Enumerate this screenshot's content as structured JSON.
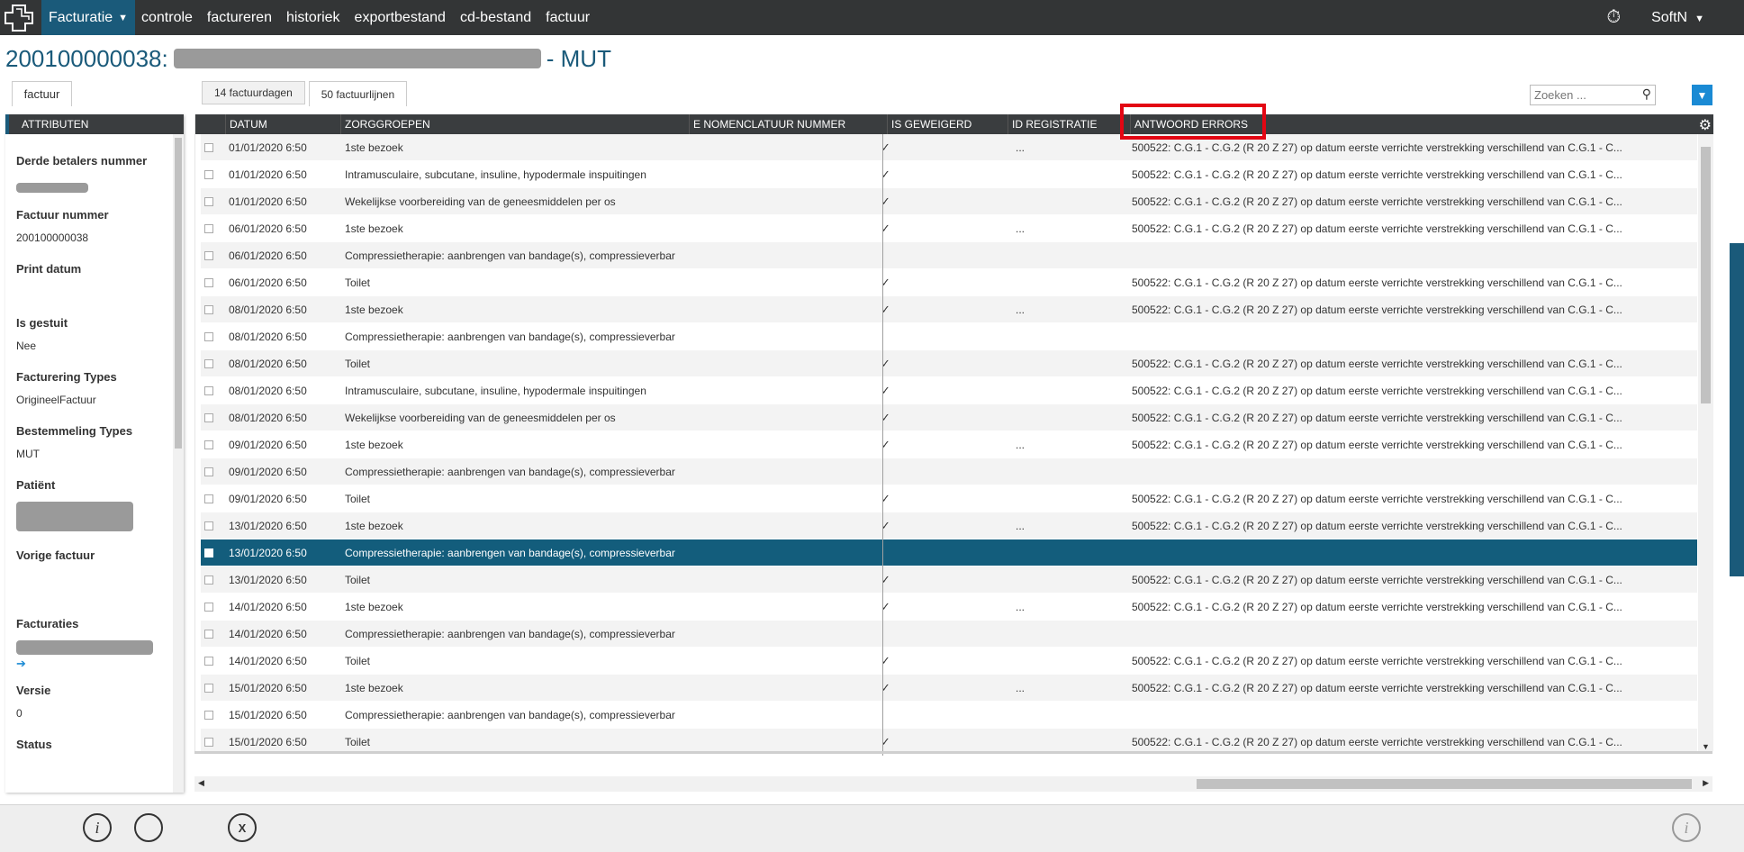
{
  "topbar": {
    "app_menu_label": "Facturatie",
    "nav": [
      "controle",
      "factureren",
      "historiek",
      "exportbestand",
      "cd-bestand",
      "factuur"
    ],
    "user": "SoftN"
  },
  "title": {
    "number": "200100000038:",
    "suffix": "- MUT"
  },
  "left": {
    "tab_label": "factuur",
    "header": "ATTRIBUTEN",
    "attributes": [
      {
        "label": "Derde betalers nummer",
        "value": ""
      },
      {
        "label": "Factuur nummer",
        "value": "200100000038"
      },
      {
        "label": "Print datum",
        "value": ""
      },
      {
        "label": "Is gestuit",
        "value": "Nee"
      },
      {
        "label": "Facturering Types",
        "value": "OrigineelFactuur"
      },
      {
        "label": "Bestemmeling Types",
        "value": "MUT"
      },
      {
        "label": "Patiënt",
        "value": ""
      },
      {
        "label": "Vorige factuur",
        "value": ""
      },
      {
        "label": "Facturaties",
        "value": "➔"
      },
      {
        "label": "Versie",
        "value": "0"
      },
      {
        "label": "Status",
        "value": ""
      }
    ]
  },
  "tabs": [
    {
      "label": "14 factuurdagen",
      "active": false
    },
    {
      "label": "50 factuurlijnen",
      "active": true
    }
  ],
  "search": {
    "placeholder": "Zoeken ..."
  },
  "grid": {
    "columns": [
      "DATUM",
      "ZORGGROEPEN",
      "E NOMENCLATUUR NUMMER",
      "IS GEWEIGERD",
      "ID REGISTRATIE",
      "ANTWOORD ERRORS"
    ],
    "error_text": "500522: C.G.1 - C.G.2 (R 20 Z 27) op datum eerste verrichte verstrekking verschillend van C.G.1 - C...",
    "rows": [
      {
        "date": "01/01/2020 6:50",
        "group": "1ste bezoek",
        "refused": "✓",
        "id": "...",
        "error": true
      },
      {
        "date": "01/01/2020 6:50",
        "group": "Intramusculaire, subcutane, insuline, hypodermale inspuitingen",
        "refused": "✓",
        "id": "",
        "error": true
      },
      {
        "date": "01/01/2020 6:50",
        "group": "Wekelijkse voorbereiding van de geneesmiddelen per os",
        "refused": "✓",
        "id": "",
        "error": true
      },
      {
        "date": "06/01/2020 6:50",
        "group": "1ste bezoek",
        "refused": "✓",
        "id": "...",
        "error": true
      },
      {
        "date": "06/01/2020 6:50",
        "group": "Compressietherapie: aanbrengen van bandage(s), compressieverbar",
        "refused": "",
        "id": "",
        "error": false
      },
      {
        "date": "06/01/2020 6:50",
        "group": "Toilet",
        "refused": "✓",
        "id": "",
        "error": true
      },
      {
        "date": "08/01/2020 6:50",
        "group": "1ste bezoek",
        "refused": "✓",
        "id": "...",
        "error": true
      },
      {
        "date": "08/01/2020 6:50",
        "group": "Compressietherapie: aanbrengen van bandage(s), compressieverbar",
        "refused": "",
        "id": "",
        "error": false
      },
      {
        "date": "08/01/2020 6:50",
        "group": "Toilet",
        "refused": "✓",
        "id": "",
        "error": true
      },
      {
        "date": "08/01/2020 6:50",
        "group": "Intramusculaire, subcutane, insuline, hypodermale inspuitingen",
        "refused": "✓",
        "id": "",
        "error": true
      },
      {
        "date": "08/01/2020 6:50",
        "group": "Wekelijkse voorbereiding van de geneesmiddelen per os",
        "refused": "✓",
        "id": "",
        "error": true
      },
      {
        "date": "09/01/2020 6:50",
        "group": "1ste bezoek",
        "refused": "✓",
        "id": "...",
        "error": true
      },
      {
        "date": "09/01/2020 6:50",
        "group": "Compressietherapie: aanbrengen van bandage(s), compressieverbar",
        "refused": "",
        "id": "",
        "error": false
      },
      {
        "date": "09/01/2020 6:50",
        "group": "Toilet",
        "refused": "✓",
        "id": "",
        "error": true
      },
      {
        "date": "13/01/2020 6:50",
        "group": "1ste bezoek",
        "refused": "✓",
        "id": "...",
        "error": true
      },
      {
        "date": "13/01/2020 6:50",
        "group": "Compressietherapie: aanbrengen van bandage(s), compressieverbar",
        "refused": "",
        "id": "",
        "error": false,
        "selected": true
      },
      {
        "date": "13/01/2020 6:50",
        "group": "Toilet",
        "refused": "✓",
        "id": "",
        "error": true
      },
      {
        "date": "14/01/2020 6:50",
        "group": "1ste bezoek",
        "refused": "✓",
        "id": "...",
        "error": true
      },
      {
        "date": "14/01/2020 6:50",
        "group": "Compressietherapie: aanbrengen van bandage(s), compressieverbar",
        "refused": "",
        "id": "",
        "error": false
      },
      {
        "date": "14/01/2020 6:50",
        "group": "Toilet",
        "refused": "✓",
        "id": "",
        "error": true
      },
      {
        "date": "15/01/2020 6:50",
        "group": "1ste bezoek",
        "refused": "✓",
        "id": "...",
        "error": true
      },
      {
        "date": "15/01/2020 6:50",
        "group": "Compressietherapie: aanbrengen van bandage(s), compressieverbar",
        "refused": "",
        "id": "",
        "error": false
      },
      {
        "date": "15/01/2020 6:50",
        "group": "Toilet",
        "refused": "✓",
        "id": "",
        "error": true
      }
    ]
  },
  "colors": {
    "brand": "#1a5a7a",
    "selected_row": "#135d7c",
    "highlight": "#e30613"
  }
}
